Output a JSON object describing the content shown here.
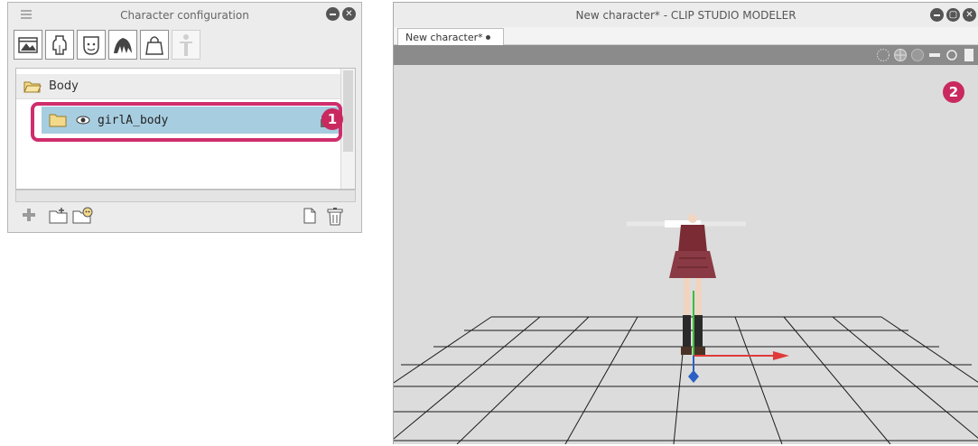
{
  "panel": {
    "title": "Character configuration",
    "tree": {
      "group_label": "Body",
      "item_label": "girlA_body"
    },
    "callout": "1"
  },
  "window": {
    "title": "New character* - CLIP STUDIO MODELER",
    "tab_label": "New character*",
    "callout": "2"
  },
  "colors": {
    "highlight": "#cf2e6c",
    "selected_row": "#a7cde0",
    "x_axis": "#e03a3a",
    "y_axis": "#3bbd3b",
    "z_axis": "#2b5fc4"
  }
}
